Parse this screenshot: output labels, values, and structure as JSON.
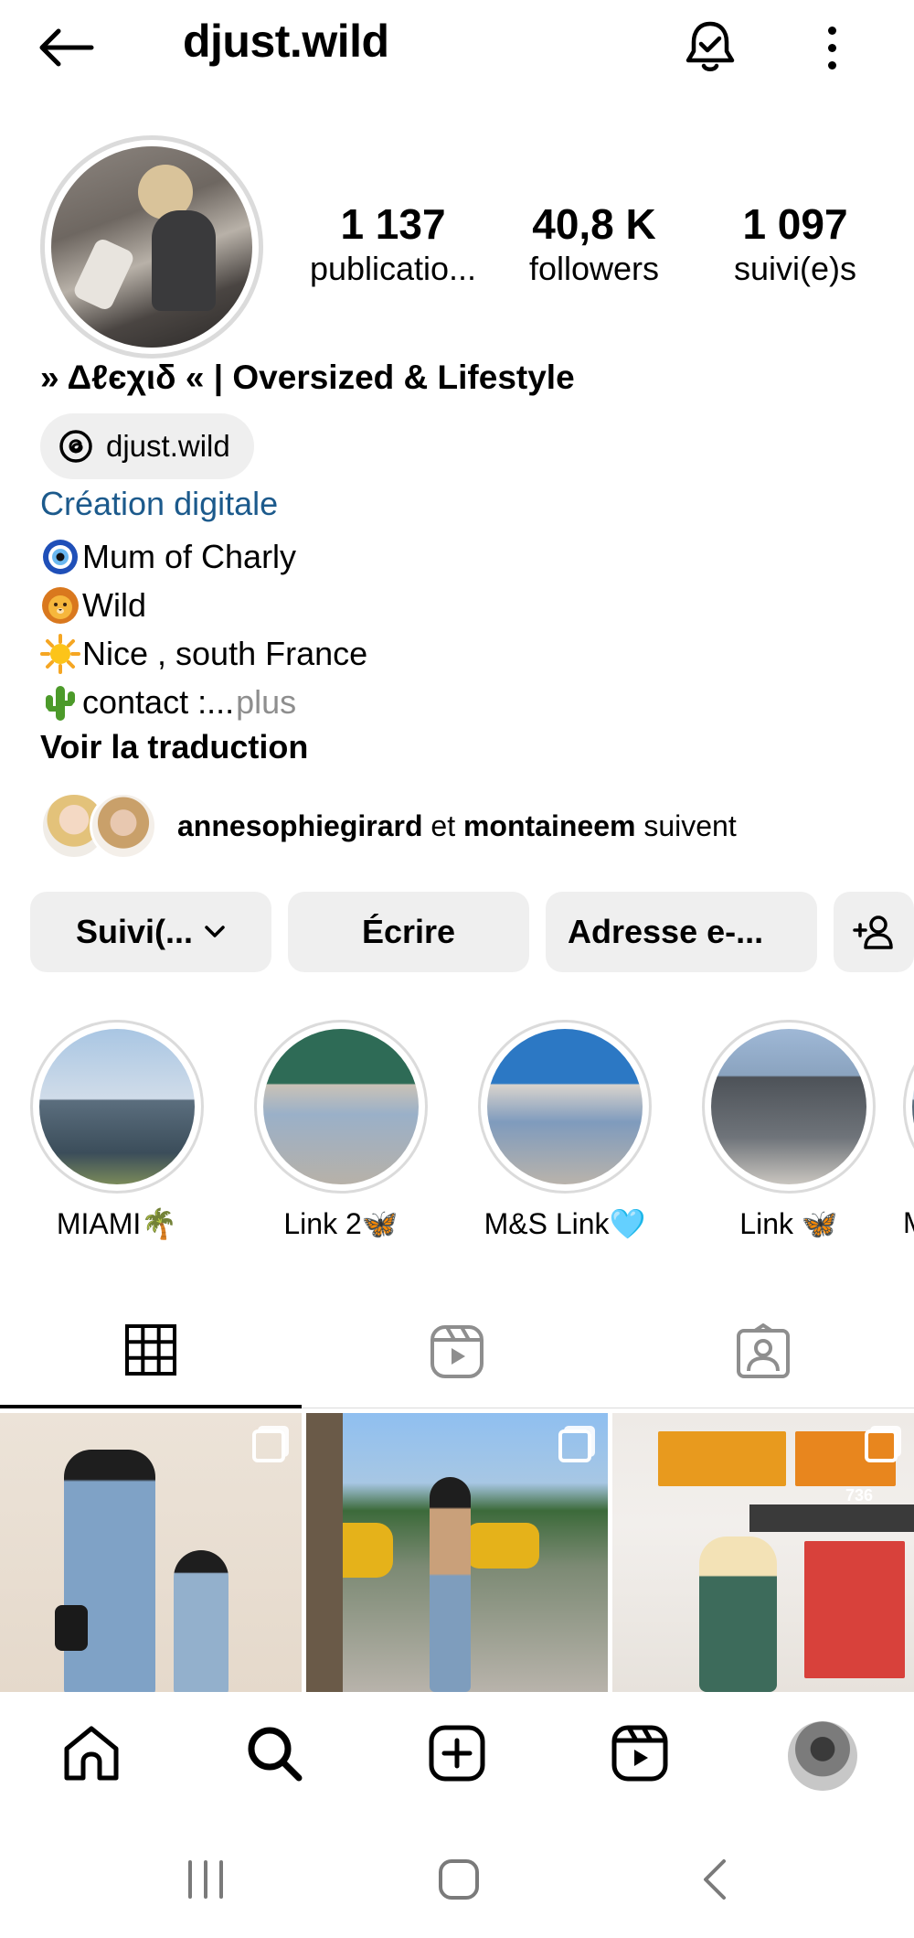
{
  "header": {
    "username": "djust.wild"
  },
  "profile": {
    "stats": [
      {
        "value": "1 137",
        "label": "publicatio..."
      },
      {
        "value": "40,8 K",
        "label": "followers"
      },
      {
        "value": "1 097",
        "label": "suivi(e)s"
      }
    ],
    "fullname": "» Δℓєχιδ « | Oversized & Lifestyle",
    "threads_handle": "djust.wild",
    "category": "Création digitale",
    "bio": [
      {
        "icon": "nazar-emoji",
        "text": "Mum of Charly"
      },
      {
        "icon": "lion-emoji",
        "text": "Wild"
      },
      {
        "icon": "sun-emoji",
        "text": "Nice , south France"
      },
      {
        "icon": "cactus-emoji",
        "text": "contact :..."
      }
    ],
    "bio_more": " plus",
    "translate": "Voir la traduction",
    "followed_by": {
      "user1": "annesophiegirard",
      "connector": " et ",
      "user2": "montaineem",
      "suffix": " suivent"
    }
  },
  "actions": {
    "following": "Suivi(...",
    "message": "Écrire",
    "email": "Adresse e-..."
  },
  "highlights": [
    {
      "label": "MIAMI🌴"
    },
    {
      "label": "Link 2🦋"
    },
    {
      "label": "M&S Link🩵"
    },
    {
      "label": "Link 🦋"
    },
    {
      "label": "M"
    }
  ],
  "grid": {
    "post3_sign": "736"
  },
  "colors": {
    "category": "#1c5a8c",
    "button_bg": "#efefef",
    "muted": "#8e8e8e",
    "divider": "#dbdbdb"
  }
}
